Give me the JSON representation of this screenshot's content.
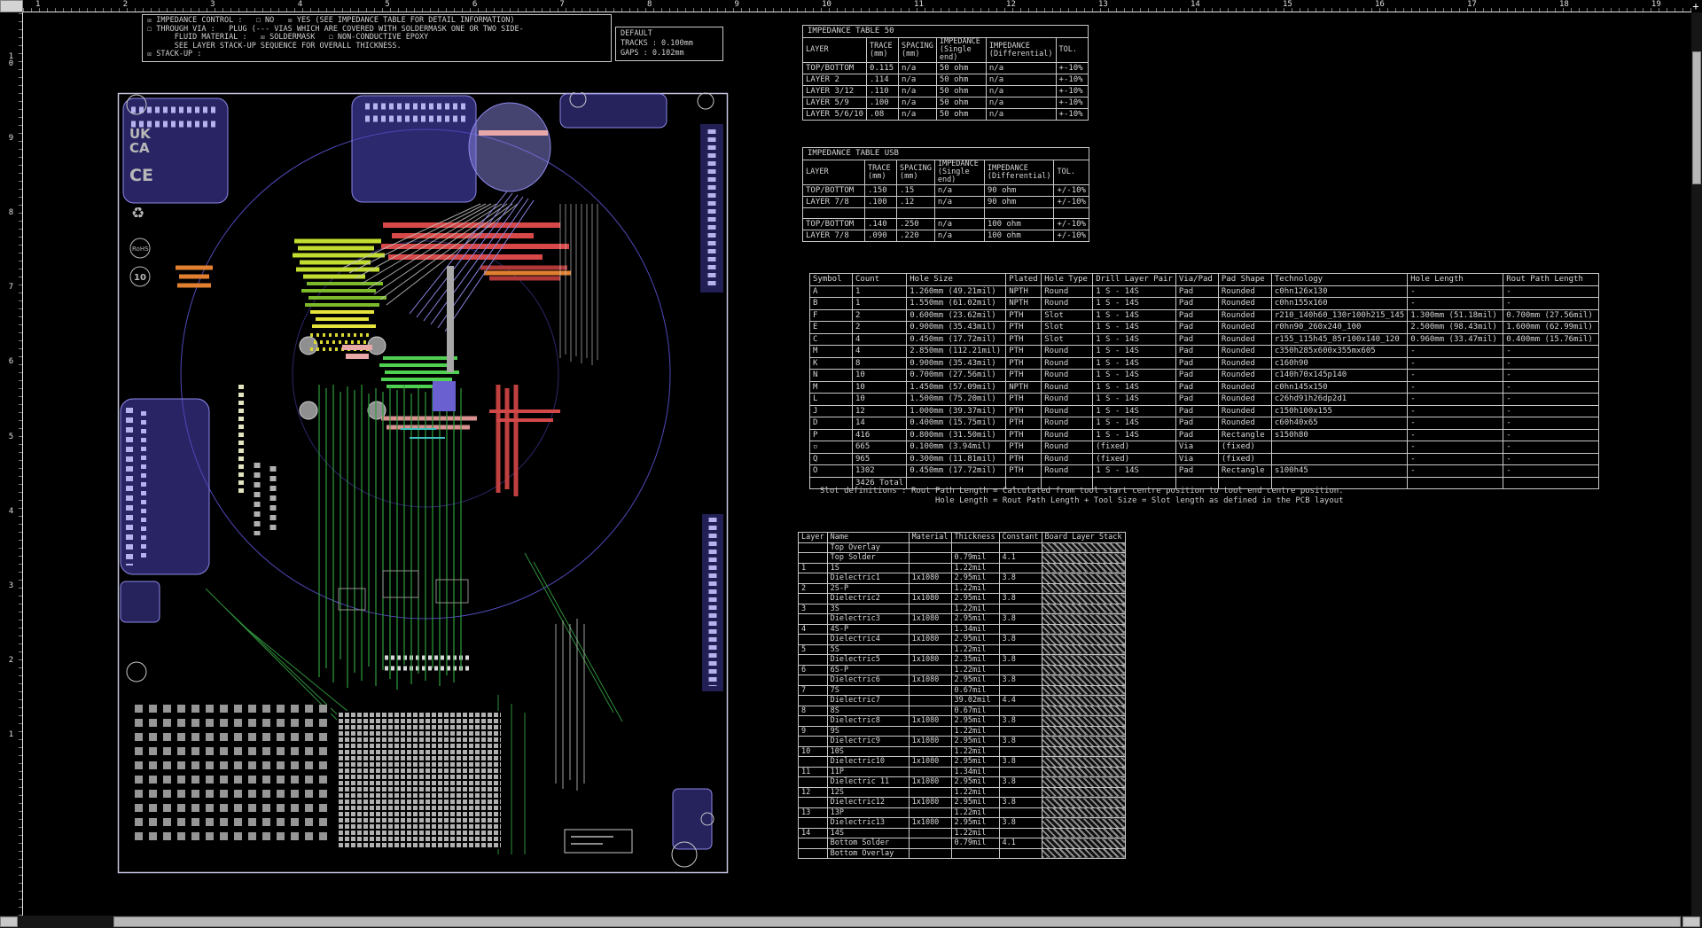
{
  "rulers": {
    "top": [
      "1",
      "2",
      "3",
      "4",
      "5",
      "6",
      "7",
      "8",
      "9",
      "10",
      "11",
      "12",
      "13",
      "14",
      "15",
      "16",
      "17",
      "18",
      "19"
    ],
    "left": [
      "10",
      "9",
      "8",
      "7",
      "6",
      "5",
      "4",
      "3",
      "2",
      "1"
    ]
  },
  "notes_box": {
    "lines": [
      "☒ IMPEDANCE CONTROL :   ☐ NO   ☒ YES (SEE IMPEDANCE TABLE FOR DETAIL INFORMATION)",
      "☐ THROUGH VIA :   PLUG (--- VIAS WHICH ARE COVERED WITH SOLDERMASK ONE OR TWO SIDE-",
      "      FLUID MATERIAL :   ☒ SOLDERMASK   ☐ NON-CONDUCTIVE EPOXY",
      "      SEE LAYER STACK-UP SEQUENCE FOR OVERALL THICKNESS.",
      "☒ STACK-UP :"
    ]
  },
  "default_box": {
    "title": "DEFAULT",
    "tracks": "TRACKS : 0.100mm",
    "gaps": "GAPS : 0.102mm"
  },
  "impedance_table_50": {
    "title": "IMPEDANCE TABLE  50",
    "header_rows": [
      [
        "LAYER",
        "TRACE (mm)",
        "SPACING (mm)",
        "IMPEDANCE (Single end)",
        "IMPEDANCE (Differential)",
        "TOL."
      ]
    ],
    "rows": [
      [
        "TOP/BOTTOM",
        "0.115",
        "n/a",
        "50 ohm",
        "n/a",
        "+-10%"
      ],
      [
        "LAYER 2",
        ".114",
        "n/a",
        "50 ohm",
        "n/a",
        "+-10%"
      ],
      [
        "LAYER 3/12",
        ".110",
        "n/a",
        "50 ohm",
        "n/a",
        "+-10%"
      ],
      [
        "LAYER 5/9",
        ".100",
        "n/a",
        "50 ohm",
        "n/a",
        "+-10%"
      ],
      [
        "LAYER 5/6/10",
        ".08",
        "n/a",
        "50 ohm",
        "n/a",
        "+-10%"
      ]
    ]
  },
  "impedance_table_usb": {
    "title": "IMPEDANCE TABLE  USB",
    "header_rows": [
      [
        "LAYER",
        "TRACE (mm)",
        "SPACING (mm)",
        "IMPEDANCE (Single end)",
        "IMPEDANCE (Differential)",
        "TOL."
      ]
    ],
    "rows": [
      [
        "TOP/BOTTOM",
        ".150",
        ".15",
        "n/a",
        "90 ohm",
        "+/-10%"
      ],
      [
        "LAYER 7/8",
        ".100",
        ".12",
        "n/a",
        "90 ohm",
        "+/-10%"
      ],
      [
        "",
        "",
        "",
        "",
        "",
        ""
      ],
      [
        "TOP/BOTTOM",
        ".140",
        ".250",
        "n/a",
        "100 ohm",
        "+/-10%"
      ],
      [
        "LAYER 7/8",
        ".090",
        ".220",
        "n/a",
        "100 ohm",
        "+/-10%"
      ]
    ]
  },
  "drill_table": {
    "header_rows": [
      [
        "Symbol",
        "Count",
        "Hole Size",
        "Plated",
        "Hole Type",
        "Drill Layer Pair",
        "Via/Pad",
        "Pad Shape",
        "Technology",
        "Hole Length",
        "Rout Path Length"
      ]
    ],
    "rows": [
      [
        "A",
        "1",
        "1.260mm (49.21mil)",
        "NPTH",
        "Round",
        "1 S - 14S",
        "Pad",
        "Rounded",
        "c0hn126x130",
        "-",
        "-"
      ],
      [
        "B",
        "1",
        "1.550mm (61.02mil)",
        "NPTH",
        "Round",
        "1 S - 14S",
        "Pad",
        "Rounded",
        "c0hn155x160",
        "-",
        "-"
      ],
      [
        "F",
        "2",
        "0.600mm (23.62mil)",
        "PTH",
        "Slot",
        "1 S - 14S",
        "Pad",
        "Rounded",
        "r210_140h60_130r100h215_145",
        "1.300mm (51.18mil)",
        "0.700mm (27.56mil)"
      ],
      [
        "E",
        "2",
        "0.900mm (35.43mil)",
        "PTH",
        "Slot",
        "1 S - 14S",
        "Pad",
        "Rounded",
        "r0hn90_260x240_100",
        "2.500mm (98.43mil)",
        "1.600mm (62.99mil)"
      ],
      [
        "C",
        "4",
        "0.450mm (17.72mil)",
        "PTH",
        "Slot",
        "1 S - 14S",
        "Pad",
        "Rounded",
        "r155_115h45_85r100x140_120",
        "0.960mm (33.47mil)",
        "0.400mm (15.76mil)"
      ],
      [
        "M",
        "4",
        "2.850mm (112.21mil)",
        "PTH",
        "Round",
        "1 S - 14S",
        "Pad",
        "Rounded",
        "c350h285x600x355mx605",
        "-",
        "-"
      ],
      [
        "K",
        "8",
        "0.900mm (35.43mil)",
        "PTH",
        "Round",
        "1 S - 14S",
        "Pad",
        "Rounded",
        "c160h90",
        "-",
        "-"
      ],
      [
        "N",
        "10",
        "0.700mm (27.56mil)",
        "PTH",
        "Round",
        "1 S - 14S",
        "Pad",
        "Rounded",
        "c140h70x145p140",
        "-",
        "-"
      ],
      [
        "M",
        "10",
        "1.450mm (57.09mil)",
        "NPTH",
        "Round",
        "1 S - 14S",
        "Pad",
        "Rounded",
        "c0hn145x150",
        "-",
        "-"
      ],
      [
        "L",
        "10",
        "1.500mm (75.20mil)",
        "PTH",
        "Round",
        "1 S - 14S",
        "Pad",
        "Rounded",
        "c26hd91h26dp2d1",
        "-",
        "-"
      ],
      [
        "J",
        "12",
        "1.000mm (39.37mil)",
        "PTH",
        "Round",
        "1 S - 14S",
        "Pad",
        "Rounded",
        "c150h100x155",
        "-",
        "-"
      ],
      [
        "D",
        "14",
        "0.400mm (15.75mil)",
        "PTH",
        "Round",
        "1 S - 14S",
        "Pad",
        "Rounded",
        "c60h40x65",
        "-",
        "-"
      ],
      [
        "P",
        "416",
        "0.800mm (31.50mil)",
        "PTH",
        "Round",
        "1 S - 14S",
        "Pad",
        "Rectangle",
        "s150h80",
        "-",
        "-"
      ],
      [
        "▫",
        "665",
        "0.100mm (3.94mil)",
        "PTH",
        "Round",
        "(fixed)",
        "Via",
        "(fixed)",
        "",
        "-",
        "-"
      ],
      [
        "Q",
        "965",
        "0.300mm (11.81mil)",
        "PTH",
        "Round",
        "(fixed)",
        "Via",
        "(fixed)",
        "",
        "-",
        "-"
      ],
      [
        "O",
        "1302",
        "0.450mm (17.72mil)",
        "PTH",
        "Round",
        "1 S - 14S",
        "Pad",
        "Rectangle",
        "s100h45",
        "-",
        "-"
      ],
      [
        "",
        "3426 Total",
        "",
        "",
        "",
        "",
        "",
        "",
        "",
        "",
        ""
      ]
    ],
    "notes": [
      "Slot definitions : Rout Path Length = Calculated from tool start centre position to tool end centre position.",
      "Hole Length = Rout Path Length + Tool Size = Slot length as defined in the PCB layout"
    ]
  },
  "stack_table": {
    "header_rows": [
      [
        "Layer",
        "Name",
        "Material",
        "Thickness",
        "Constant",
        "Board Layer Stack"
      ]
    ],
    "rows": [
      [
        "",
        "Top Overlay",
        "",
        "",
        "",
        ""
      ],
      [
        "",
        "Top Solder",
        "",
        "0.79mil",
        "4.1",
        ""
      ],
      [
        "1",
        "1S",
        "",
        "1.22mil",
        "",
        ""
      ],
      [
        "",
        "Dielectric1",
        "1x1080",
        "2.95mil",
        "3.8",
        ""
      ],
      [
        "2",
        "2S-P",
        "",
        "1.22mil",
        "",
        ""
      ],
      [
        "",
        "Dielectric2",
        "1x1080",
        "2.95mil",
        "3.8",
        ""
      ],
      [
        "3",
        "3S",
        "",
        "1.22mil",
        "",
        ""
      ],
      [
        "",
        "Dielectric3",
        "1x1080",
        "2.95mil",
        "3.8",
        ""
      ],
      [
        "4",
        "4S-P",
        "",
        "1.34mil",
        "",
        ""
      ],
      [
        "",
        "Dielectric4",
        "1x1080",
        "2.95mil",
        "3.8",
        ""
      ],
      [
        "5",
        "5S",
        "",
        "1.22mil",
        "",
        ""
      ],
      [
        "",
        "Dielectric5",
        "1x1080",
        "2.35mil",
        "3.8",
        ""
      ],
      [
        "6",
        "6S-P",
        "",
        "1.22mil",
        "",
        ""
      ],
      [
        "",
        "Dielectric6",
        "1x1080",
        "2.95mil",
        "3.8",
        ""
      ],
      [
        "7",
        "7S",
        "",
        "0.67mil",
        "",
        ""
      ],
      [
        "",
        "Dielectric7",
        "",
        "39.02mil",
        "4.4",
        ""
      ],
      [
        "8",
        "8S",
        "",
        "0.67mil",
        "",
        ""
      ],
      [
        "",
        "Dielectric8",
        "1x1080",
        "2.95mil",
        "3.8",
        ""
      ],
      [
        "9",
        "9S",
        "",
        "1.22mil",
        "",
        ""
      ],
      [
        "",
        "Dielectric9",
        "1x1080",
        "2.95mil",
        "3.8",
        ""
      ],
      [
        "10",
        "10S",
        "",
        "1.22mil",
        "",
        ""
      ],
      [
        "",
        "Dielectric10",
        "1x1080",
        "2.95mil",
        "3.8",
        ""
      ],
      [
        "11",
        "11P",
        "",
        "1.34mil",
        "",
        ""
      ],
      [
        "",
        "Dielectric 11",
        "1x1080",
        "2.95mil",
        "3.8",
        ""
      ],
      [
        "12",
        "12S",
        "",
        "1.22mil",
        "",
        ""
      ],
      [
        "",
        "Dielectric12",
        "1x1080",
        "2.95mil",
        "3.8",
        ""
      ],
      [
        "13",
        "13P",
        "",
        "1.22mil",
        "",
        ""
      ],
      [
        "",
        "Dielectric13",
        "1x1080",
        "2.95mil",
        "3.8",
        ""
      ],
      [
        "14",
        "14S",
        "",
        "1.22mil",
        "",
        ""
      ],
      [
        "",
        "Bottom Solder",
        "",
        "0.79mil",
        "4.1",
        ""
      ],
      [
        "",
        "Bottom Overlay",
        "",
        "",
        "",
        ""
      ]
    ]
  },
  "board": {
    "marks": {
      "ukca1": "UK",
      "ukca2": "CA",
      "ce": "CE",
      "recycle": "♻",
      "rohs": "RoHS",
      "ten": "10"
    }
  },
  "scroll": {
    "corner_plus": "+"
  }
}
